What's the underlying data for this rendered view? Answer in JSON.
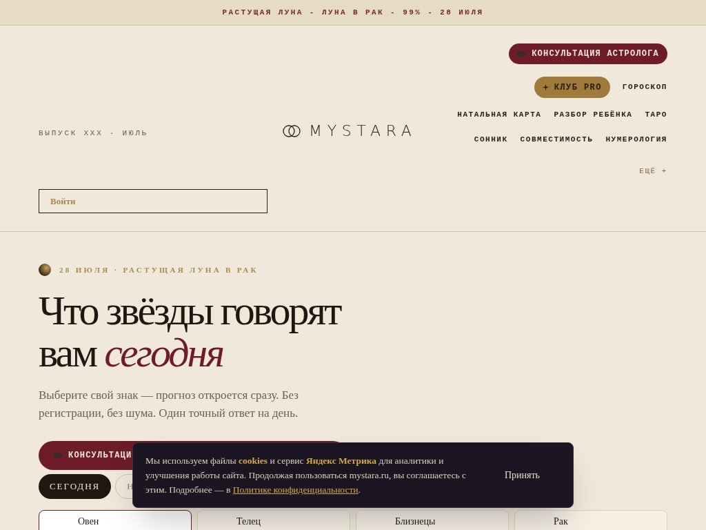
{
  "announcement": "РАСТУЩАЯ ЛУНА - ЛУНА В РАК - 99% - 28 ИЮЛЯ",
  "header": {
    "issue": "ВЫПУСК XXX · ИЮЛЬ",
    "logo": "MYSTARA",
    "consult_button": "КОНСУЛЬТАЦИЯ АСТРОЛОГА",
    "nav_rows": [
      [
        {
          "label": "КЛУБ PRO",
          "kind": "pro"
        },
        {
          "label": "ГОРОСКОП",
          "kind": "link"
        }
      ],
      [
        {
          "label": "НАТАЛЬНАЯ КАРТА",
          "kind": "link"
        },
        {
          "label": "РАЗБОР РЕБЁНКА",
          "kind": "link"
        },
        {
          "label": "ТАРО",
          "kind": "link"
        }
      ],
      [
        {
          "label": "СОННИК",
          "kind": "link"
        },
        {
          "label": "СОВМЕСТИМОСТЬ",
          "kind": "link"
        },
        {
          "label": "НУМЕРОЛОГИЯ",
          "kind": "link"
        }
      ],
      [
        {
          "label": "ЕЩЁ +",
          "kind": "more"
        }
      ]
    ],
    "login_placeholder": "Войти"
  },
  "hero": {
    "kicker": "28 ИЮЛЯ · РАСТУЩАЯ ЛУНА В РАК",
    "title": "Что звёзды говорят вам",
    "title_accent": "сегодня",
    "lead": "Выберите свой знак — прогноз откроется сразу. Без регистрации, без шума. Один точный ответ на день.",
    "consult_button": "КОНСУЛЬТАЦИ",
    "periods": [
      {
        "label": "СЕГОДНЯ",
        "selected": true
      },
      {
        "label": "Н",
        "selected": false
      }
    ],
    "signs": [
      {
        "label": "Овен",
        "selected": true
      },
      {
        "label": "Телец",
        "selected": false
      },
      {
        "label": "Близнецы",
        "selected": false
      },
      {
        "label": "Рак",
        "selected": false
      }
    ]
  },
  "cookie_banner": {
    "text": "Мы используем файлы **cookies** и сервис **Яндекс Метрика** для аналитики и улучшения работы сайта. Продолжая пользоваться mystara.ru, вы соглашаетесь с этим. Подробнее — в ",
    "link": "Политике конфиденциальности",
    "end": ".",
    "accept": "Принять"
  }
}
